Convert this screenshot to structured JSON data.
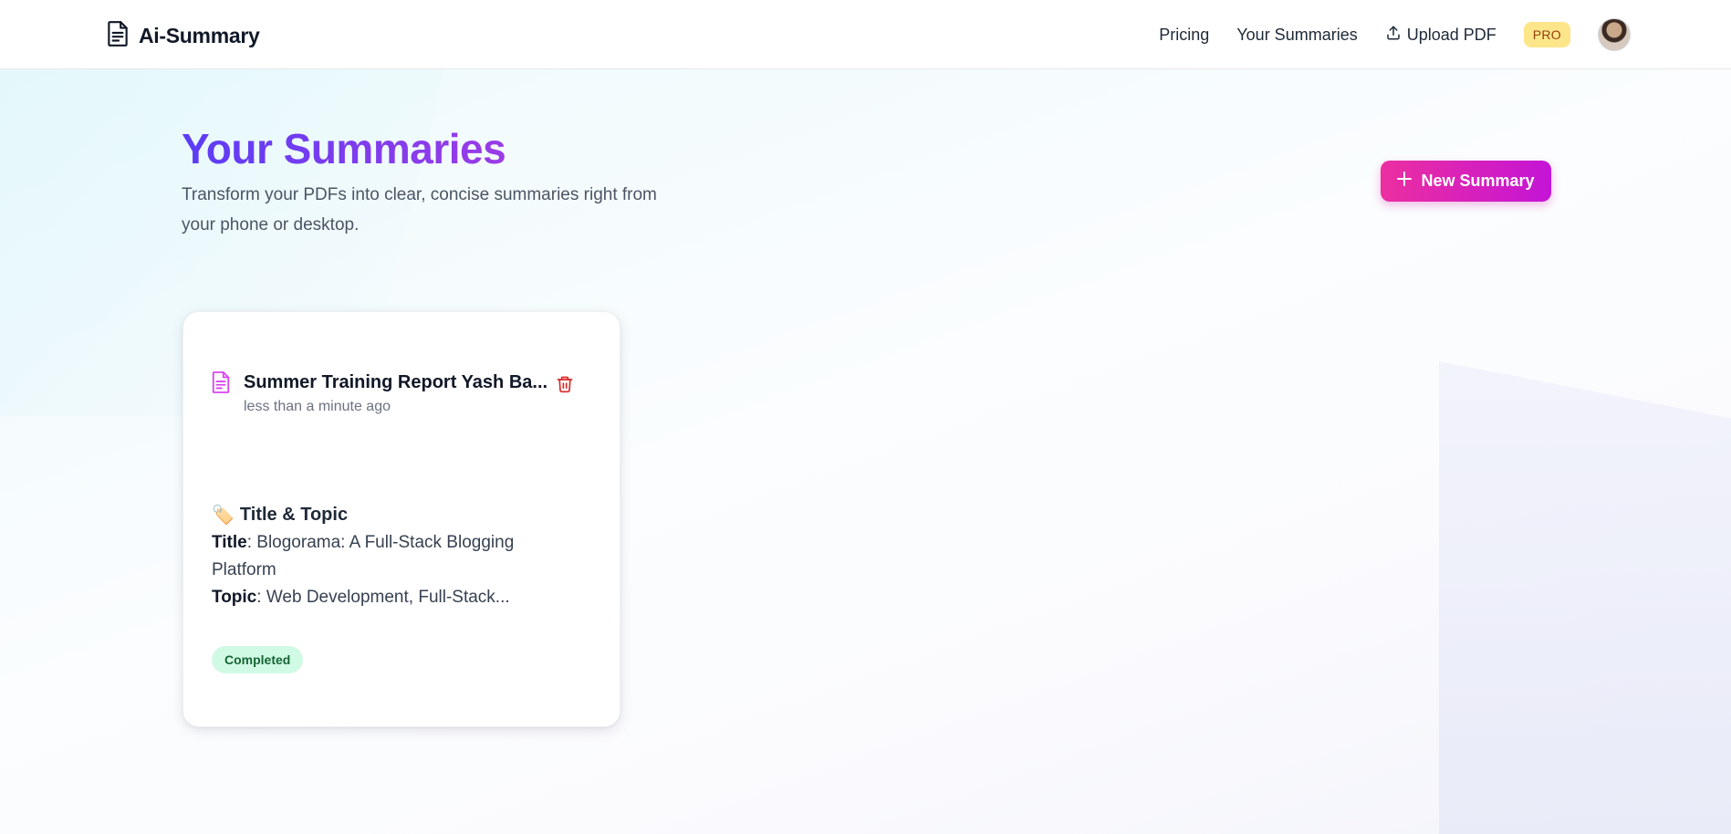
{
  "brand": {
    "name": "Ai-Summary",
    "icon": "file-text-icon"
  },
  "nav": {
    "pricing": "Pricing",
    "your_summaries": "Your Summaries",
    "upload_pdf": "Upload PDF",
    "upload_icon": "upload-icon",
    "pro_badge": "PRO"
  },
  "page": {
    "title": "Your Summaries",
    "subtitle": "Transform your PDFs into clear, concise summaries right from your phone or desktop.",
    "new_summary_label": "New Summary",
    "new_summary_icon": "plus-icon"
  },
  "summaries": [
    {
      "title": "Summer Training Report Yash Ba...",
      "time": "less than a minute ago",
      "section_emoji": "🏷️",
      "section_heading": "Title & Topic",
      "title_label": "Title",
      "title_value": ": Blogorama: A Full-Stack Blogging Platform",
      "topic_label": "Topic",
      "topic_value": ": Web Development, Full-Stack...",
      "status": "Completed"
    }
  ],
  "colors": {
    "title_gradient_start": "#5b3df5",
    "title_gradient_end": "#9b3ce6",
    "button_gradient_start": "#ec2fa0",
    "button_gradient_end": "#c414d6",
    "pro_badge_bg": "#fde68a",
    "status_bg": "#d1fae5",
    "status_text": "#166534",
    "trash": "#dc2626",
    "doc_icon": "#d946ef"
  }
}
